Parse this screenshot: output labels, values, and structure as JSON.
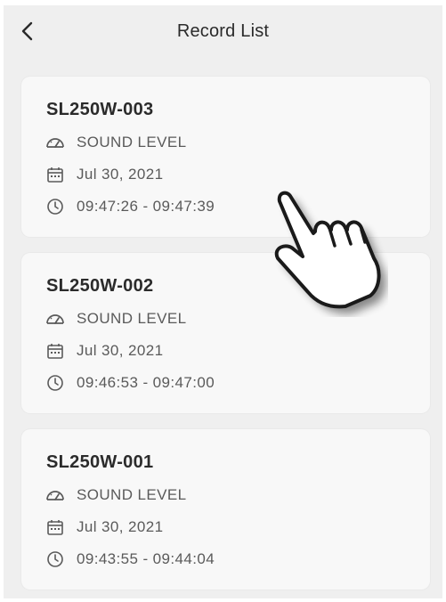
{
  "header": {
    "title": "Record List",
    "back_icon": "chevron-left-icon"
  },
  "records": [
    {
      "id": "SL250W-003",
      "type": "SOUND LEVEL",
      "date": "Jul 30, 2021",
      "time_range": "09:47:26 - 09:47:39"
    },
    {
      "id": "SL250W-002",
      "type": "SOUND LEVEL",
      "date": "Jul 30, 2021",
      "time_range": "09:46:53 - 09:47:00"
    },
    {
      "id": "SL250W-001",
      "type": "SOUND LEVEL",
      "date": "Jul 30, 2021",
      "time_range": "09:43:55 - 09:44:04"
    }
  ],
  "icons": {
    "type": "gauge-icon",
    "date": "calendar-icon",
    "time": "clock-icon",
    "pointer": "tap-hand-icon"
  },
  "colors": {
    "background": "#efefef",
    "card": "#f8f8f8",
    "text_primary": "#2b2b2b",
    "text_secondary": "#5a5a5a"
  }
}
